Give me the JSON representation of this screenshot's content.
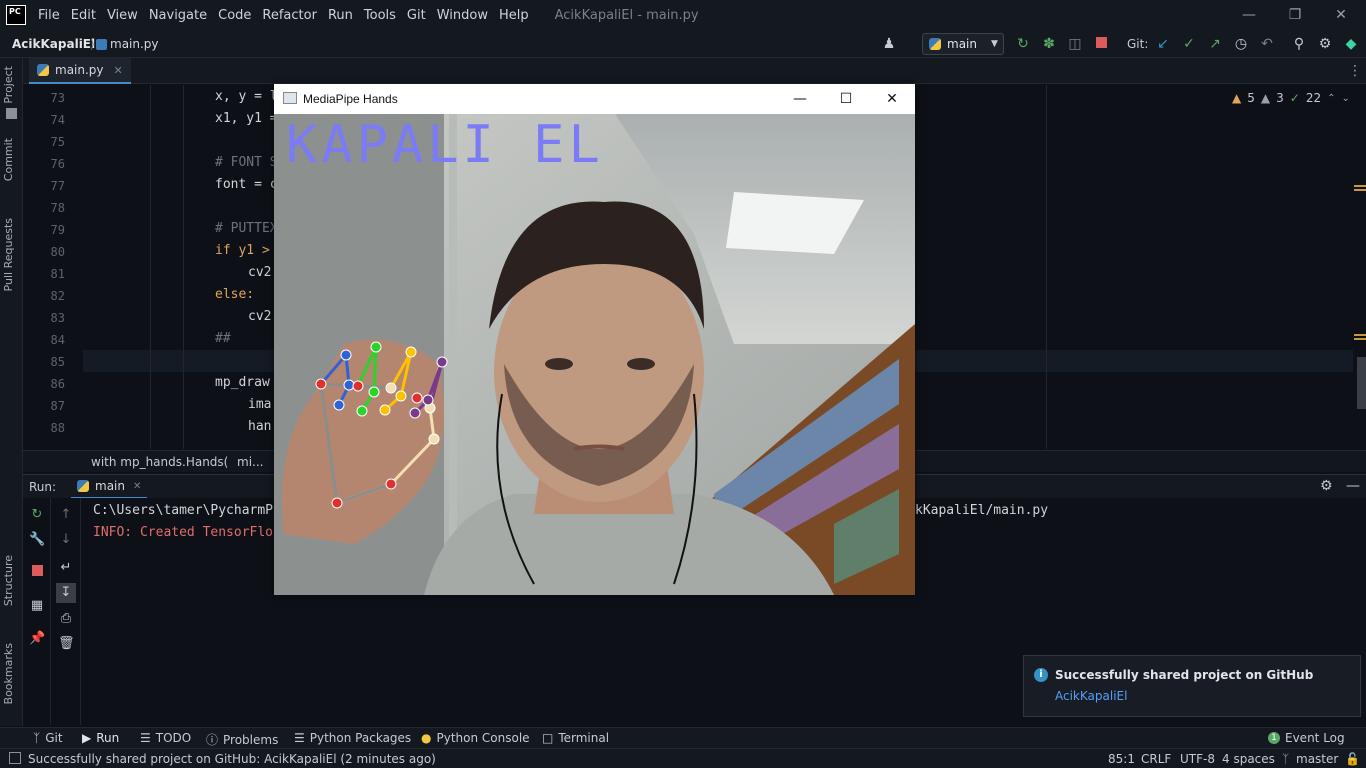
{
  "menubar": {
    "logo": "PC",
    "items": [
      "File",
      "Edit",
      "View",
      "Navigate",
      "Code",
      "Refactor",
      "Run",
      "Tools",
      "Git",
      "Window",
      "Help"
    ],
    "window_title": "AcikKapaliEl - main.py"
  },
  "navbar": {
    "project": "AcikKapaliEl",
    "file": "main.py",
    "branch": "main",
    "git_label": "Git:"
  },
  "left_tabs": [
    "Project",
    "Commit",
    "Pull Requests",
    "Structure",
    "Bookmarks"
  ],
  "editor": {
    "tab": "main.py",
    "line_numbers": [
      "73",
      "74",
      "75",
      "76",
      "77",
      "78",
      "79",
      "80",
      "81",
      "82",
      "83",
      "84",
      "85",
      "86",
      "87",
      "88"
    ],
    "lines": [
      {
        "indent": 0,
        "text": "x, y = l",
        "cls": ""
      },
      {
        "indent": 0,
        "text": "x1, y1 =",
        "cls": ""
      },
      {
        "indent": 0,
        "text": "",
        "cls": ""
      },
      {
        "indent": 0,
        "text": "# FONT S",
        "cls": "cm"
      },
      {
        "indent": 0,
        "text": "font = c",
        "cls": ""
      },
      {
        "indent": 0,
        "text": "",
        "cls": ""
      },
      {
        "indent": 0,
        "text": "# PUTTEX",
        "cls": "cm"
      },
      {
        "indent": 0,
        "text": "if y1 >",
        "cls": "kw"
      },
      {
        "indent": 1,
        "text": "cv2",
        "cls": ""
      },
      {
        "indent": 0,
        "text": "else:",
        "cls": "kw"
      },
      {
        "indent": 1,
        "text": "cv2",
        "cls": ""
      },
      {
        "indent": 0,
        "text": "##",
        "cls": "cm"
      },
      {
        "indent": 0,
        "text": "",
        "cls": ""
      },
      {
        "indent": 0,
        "text": "mp_draw",
        "cls": ""
      },
      {
        "indent": 1,
        "text": "ima",
        "cls": ""
      },
      {
        "indent": 1,
        "text": "han",
        "cls": ""
      }
    ],
    "inspections": {
      "warnings": "5",
      "weak": "3",
      "ok": "22"
    },
    "sticky": "with mp_hands.Hands(",
    "sticky_tail": "mi..."
  },
  "run": {
    "label": "Run:",
    "tab": "main",
    "console_line1": "C:\\Users\\tamer\\PycharmP",
    "console_line1_tail": "kKapaliEl/main.py",
    "console_line2": "INFO: Created TensorFlo"
  },
  "notification": {
    "title": "Successfully shared project on GitHub",
    "link": "AcikKapaliEl"
  },
  "toolwindows": [
    "Git",
    "Run",
    "TODO",
    "Problems",
    "Python Packages",
    "Python Console",
    "Terminal"
  ],
  "event_log": "Event Log",
  "status": {
    "message": "Successfully shared project on GitHub: AcikKapaliEl (2 minutes ago)",
    "position": "85:1",
    "line_sep": "CRLF",
    "encoding": "UTF-8",
    "indent": "4 spaces",
    "branch": "master"
  },
  "mediapipe": {
    "title": "MediaPipe Hands",
    "overlay_text": "KAPALI EL",
    "overlay_color": "#7b7bf5"
  }
}
